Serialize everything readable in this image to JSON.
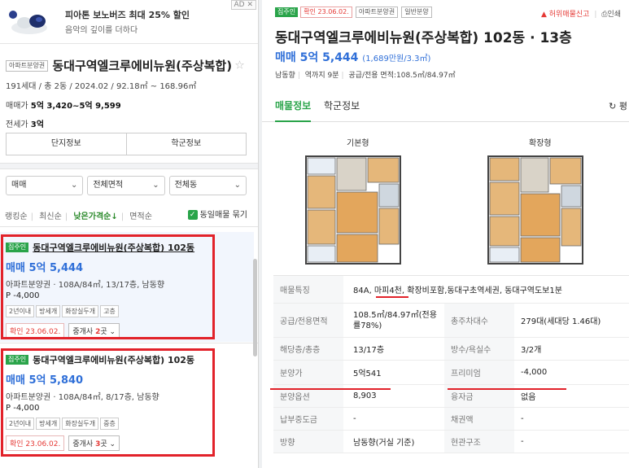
{
  "ad": {
    "title": "피아톤 보노버즈 최대 25% 할인",
    "subtitle": "음악의 깊이를 더하다",
    "badge": "AD ✕"
  },
  "complex": {
    "type_tag": "아파트분양권",
    "name": "동대구역엘크루에비뉴원(주상복합)",
    "star": "☆",
    "meta": "191세대 / 총 2동 / 2024.02 / 92.18㎡ ~ 168.96㎡",
    "sale_label": "매매가",
    "sale_value": "5억 3,420~5억 9,599",
    "jeonse_label": "전세가",
    "jeonse_value": "3억"
  },
  "buttons": {
    "complex_info": "단지정보",
    "school_info": "학군정보"
  },
  "filters": {
    "trade": "매매",
    "area": "전체면적",
    "building": "전체동"
  },
  "sort": {
    "ranking": "랭킹순",
    "latest": "최신순",
    "low_price": "낮은가격순↓",
    "area": "면적순",
    "group_label": "동일매물 묶기"
  },
  "listings": [
    {
      "owner_tag": "집주인",
      "title": "동대구역엘크루에비뉴원(주상복합) 102동",
      "price": "매매 5억 5,444",
      "spec": "아파트분양권 · 108A/84㎡, 13/17층, 남동향",
      "premium": "P -4,000",
      "chips": [
        "2년이내",
        "방세개",
        "화장실두개",
        "고층"
      ],
      "confirm": "확인 23.06.02.",
      "broker_prefix": "중개사 ",
      "broker_count": "2",
      "broker_suffix": "곳 ⌄"
    },
    {
      "owner_tag": "집주인",
      "title": "동대구역엘크루에비뉴원(주상복합) 102동",
      "price": "매매 5억 5,840",
      "spec": "아파트분양권 · 108A/84㎡, 8/17층, 남동향",
      "premium": "P -4,000",
      "chips": [
        "2년이내",
        "방세개",
        "화장실두개",
        "중층"
      ],
      "confirm": "확인 23.06.02.",
      "broker_prefix": "중개사 ",
      "broker_count": "3",
      "broker_suffix": "곳 ⌄"
    }
  ],
  "detail": {
    "tags": [
      "집주인",
      "확인 23.06.02.",
      "아파트분양권",
      "일반분양"
    ],
    "report": "허위매물신고",
    "print": "인쇄",
    "title": "동대구역엘크루에비뉴원(주상복합) 102동 · 13층",
    "price": "매매 5억 5,444",
    "price_per": "(1,689만원/3.3㎡)",
    "direction": "남동향",
    "station": "역까지 9분",
    "area": "공급/전용 면적:108.5㎡/84.97㎡",
    "tab_listing": "매물정보",
    "tab_school": "학군정보",
    "refresh": "↻ 평",
    "plan_basic": "기본형",
    "plan_ext": "확장형",
    "rows": [
      {
        "l1": "매물특징",
        "v1": "84A, 마피4천, 확장비포함,동대구초역세권, 동대구역도보1분"
      },
      {
        "l1": "공급/전용면적",
        "v1": "108.5㎡/84.97㎡(전용률78%)",
        "l2": "총주차대수",
        "v2": "279대(세대당 1.46대)"
      },
      {
        "l1": "해당층/총층",
        "v1": "13/17층",
        "l2": "방수/욕실수",
        "v2": "3/2개"
      },
      {
        "l1": "분양가",
        "v1": "5억541",
        "l2": "프리미엄",
        "v2": "-4,000"
      },
      {
        "l1": "분양옵션",
        "v1": "8,903",
        "l2": "융자금",
        "v2": "없음"
      },
      {
        "l1": "납부중도금",
        "v1": "-",
        "l2": "채권액",
        "v2": "-"
      },
      {
        "l1": "방향",
        "v1": "남동향(거실 기준)",
        "l2": "현관구조",
        "v2": "-"
      }
    ]
  }
}
